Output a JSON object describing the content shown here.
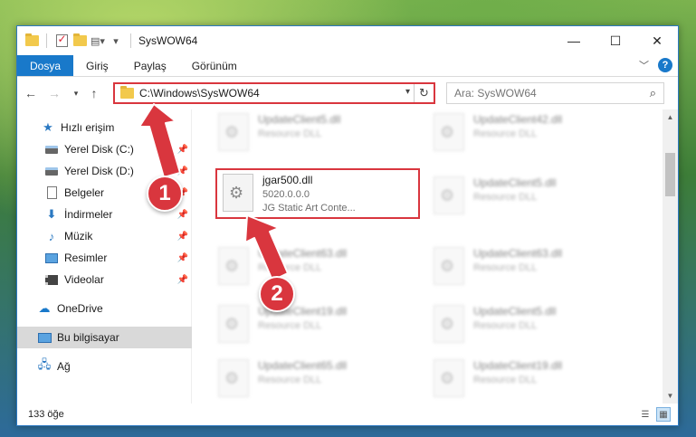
{
  "window": {
    "title": "SysWOW64",
    "controls": {
      "minimize": "—",
      "maximize": "☐",
      "close": "✕"
    }
  },
  "ribbon": {
    "tabs": [
      "Dosya",
      "Giriş",
      "Paylaş",
      "Görünüm"
    ],
    "help_label": "?"
  },
  "navigation": {
    "address_path": "C:\\Windows\\SysWOW64",
    "search_placeholder": "Ara: SysWOW64"
  },
  "sidebar": {
    "items": [
      {
        "label": "Hızlı erişim",
        "icon": "star-icon"
      },
      {
        "label": "Yerel Disk (C:)",
        "icon": "drive-icon",
        "pinned": true
      },
      {
        "label": "Yerel Disk (D:)",
        "icon": "drive-icon",
        "pinned": true
      },
      {
        "label": "Belgeler",
        "icon": "document-icon",
        "pinned": true
      },
      {
        "label": "İndirmeler",
        "icon": "download-icon",
        "pinned": true
      },
      {
        "label": "Müzik",
        "icon": "music-icon",
        "pinned": true
      },
      {
        "label": "Resimler",
        "icon": "pictures-icon",
        "pinned": true
      },
      {
        "label": "Videolar",
        "icon": "videos-icon",
        "pinned": true
      },
      {
        "label": "OneDrive",
        "icon": "onedrive-icon"
      },
      {
        "label": "Bu bilgisayar",
        "icon": "computer-icon",
        "selected": true
      },
      {
        "label": "Ağ",
        "icon": "network-icon"
      }
    ]
  },
  "files": {
    "highlighted": {
      "name": "jgar500.dll",
      "version": "5020.0.0.0",
      "description": "JG Static Art Conte..."
    },
    "left_column": [
      {
        "name": "UpdateClient5.dll",
        "description": "Resource DLL"
      },
      {
        "name": "UpdateClient63.dll",
        "description": "Resource DLL"
      },
      {
        "name": "UpdateClient19.dll",
        "description": "Resource DLL"
      },
      {
        "name": "UpdateClient65.dll",
        "description": "Resource DLL"
      }
    ],
    "right_column": [
      {
        "name": "UpdateClient42.dll",
        "description": "Resource DLL"
      },
      {
        "name": "UpdateClient5.dll",
        "description": "Resource DLL"
      },
      {
        "name": "UpdateClient63.dll",
        "description": "Resource DLL"
      },
      {
        "name": "UpdateClient5.dll",
        "description": "Resource DLL"
      },
      {
        "name": "UpdateClient19.dll",
        "description": "Resource DLL"
      }
    ]
  },
  "statusbar": {
    "item_count": "133 öğe"
  },
  "annotations": {
    "step1": "1",
    "step2": "2"
  },
  "colors": {
    "accent": "#1979ca",
    "highlight": "#d9363e"
  }
}
